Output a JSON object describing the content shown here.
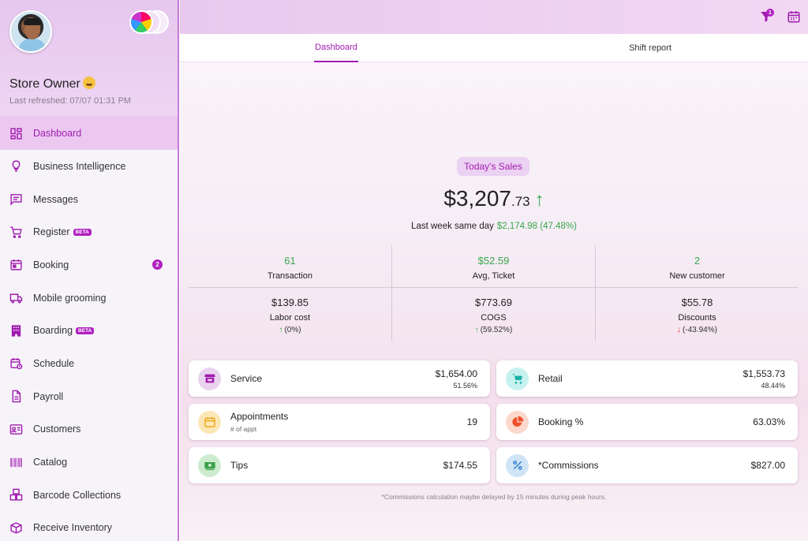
{
  "profile": {
    "name": "Store Owner",
    "last_refreshed": "Last refreshed: 07/07 01:31 PM"
  },
  "nav": {
    "items": [
      {
        "label": "Dashboard",
        "icon": "dashboard-grid-icon",
        "active": true
      },
      {
        "label": "Business Intelligence",
        "icon": "lightbulb-icon"
      },
      {
        "label": "Messages",
        "icon": "message-icon"
      },
      {
        "label": "Register",
        "icon": "cart-icon",
        "badge": "BETA"
      },
      {
        "label": "Booking",
        "icon": "calendar-icon",
        "count": "2"
      },
      {
        "label": "Mobile grooming",
        "icon": "van-icon"
      },
      {
        "label": "Boarding",
        "icon": "building-icon",
        "badge": "BETA"
      },
      {
        "label": "Schedule",
        "icon": "schedule-icon"
      },
      {
        "label": "Payroll",
        "icon": "document-icon"
      },
      {
        "label": "Customers",
        "icon": "id-card-icon"
      },
      {
        "label": "Catalog",
        "icon": "barcode-icon"
      },
      {
        "label": "Barcode Collections",
        "icon": "boxes-icon"
      },
      {
        "label": "Receive Inventory",
        "icon": "inventory-box-icon"
      }
    ]
  },
  "topbar": {
    "filter_count": "1"
  },
  "tabs": [
    "Dashboard",
    "Shift report"
  ],
  "sales": {
    "pill": "Today's Sales",
    "dollars": "$3,207",
    "cents": ".73",
    "trend": "↑",
    "lastweek_label": "Last week same day",
    "lastweek_value": "$2,174.98 (47.48%)"
  },
  "stats": {
    "transaction": {
      "value": "61",
      "label": "Transaction"
    },
    "avg_ticket": {
      "value": "$52.59",
      "label": "Avg, Ticket"
    },
    "new_customer": {
      "value": "2",
      "label": "New customer"
    },
    "labor": {
      "value": "$139.85",
      "label": "Labor cost",
      "delta": "(0%)"
    },
    "cogs": {
      "value": "$773.69",
      "label": "COGS",
      "delta": "(59.52%)"
    },
    "discounts": {
      "value": "$55.78",
      "label": "Discounts",
      "delta": "(-43.94%)"
    }
  },
  "cards": {
    "service": {
      "title": "Service",
      "amount": "$1,654.00",
      "pct": "51.56%"
    },
    "retail": {
      "title": "Retail",
      "amount": "$1,553.73",
      "pct": "48.44%"
    },
    "appointments": {
      "title": "Appointments",
      "sub": "# of appt",
      "amount": "19"
    },
    "booking": {
      "title": "Booking %",
      "amount": "63.03%"
    },
    "tips": {
      "title": "Tips",
      "amount": "$174.55"
    },
    "commissions": {
      "title": "*Commissions",
      "amount": "$827.00"
    }
  },
  "footnote": "*Commissions calculation maybe delayed by 15 minutes during peak hours.",
  "colors": {
    "accent": "#a01bb0",
    "positive": "#37a84b",
    "negative": "#e0352b"
  }
}
